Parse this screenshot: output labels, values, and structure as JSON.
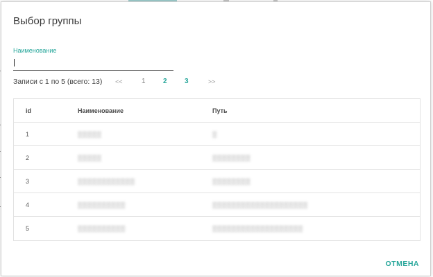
{
  "dialog": {
    "title": "Выбор группы",
    "cancel_label": "ОТМЕНА"
  },
  "filter": {
    "label": "Наименование",
    "value": "",
    "placeholder": ""
  },
  "pagination": {
    "info": "Записи с 1 по 5 (всего: 13)",
    "first": "<<",
    "pages": [
      "1",
      "2",
      "3"
    ],
    "current_page": "1",
    "last": ">>"
  },
  "table": {
    "columns": [
      "id",
      "Наименование",
      "Путь"
    ],
    "rows": [
      {
        "id": "1",
        "name": "",
        "path": ""
      },
      {
        "id": "2",
        "name": "",
        "path": ""
      },
      {
        "id": "3",
        "name": "",
        "path": ""
      },
      {
        "id": "4",
        "name": "",
        "path": ""
      },
      {
        "id": "5",
        "name": "",
        "path": ""
      }
    ]
  },
  "colors": {
    "accent": "#26a69a",
    "text": "#3a3a3a",
    "border": "#e2e2e2"
  }
}
